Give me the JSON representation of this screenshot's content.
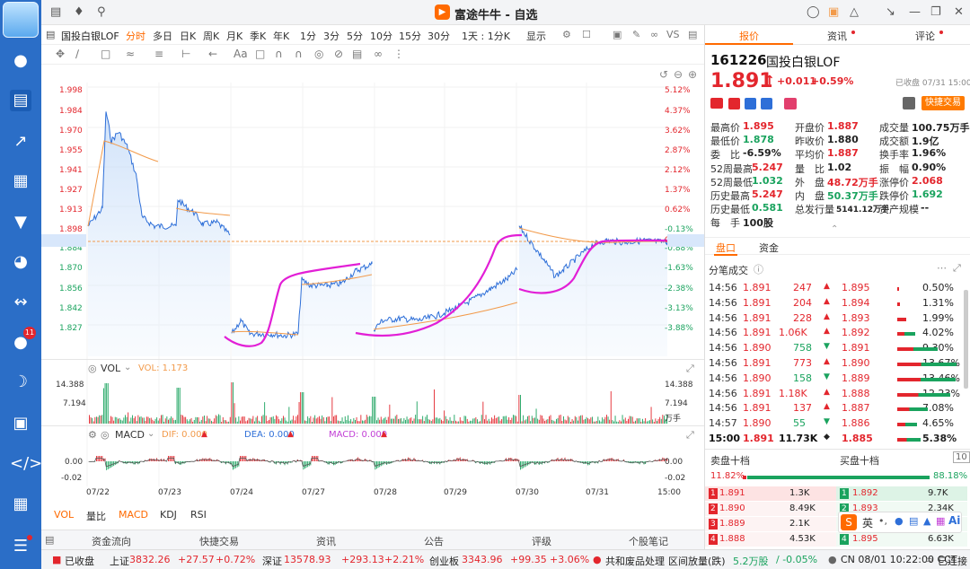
{
  "window": {
    "title": "富途牛牛 - 自选"
  },
  "rail": {
    "badge": "11"
  },
  "toolbar": {
    "stock_name": "国投白银LOF",
    "periods": [
      "分时",
      "多日",
      "日K",
      "周K",
      "月K",
      "季K",
      "年K",
      "1分",
      "3分",
      "5分",
      "10分",
      "15分",
      "30分",
      "1天 : 1分K",
      "显示"
    ],
    "active_period": "分时",
    "vs_label": "VS"
  },
  "chart": {
    "price_ticks": [
      "1.998",
      "1.984",
      "1.970",
      "1.955",
      "1.941",
      "1.927",
      "1.913",
      "1.898",
      "1.891",
      "1.884",
      "1.870",
      "1.856",
      "1.842",
      "1.827"
    ],
    "pct_ticks": [
      "5.12%",
      "4.37%",
      "3.62%",
      "2.87%",
      "2.12%",
      "1.37%",
      "0.62%",
      "-0.13%",
      "0.53%",
      "-0.88%",
      "-1.63%",
      "-2.38%",
      "-3.13%",
      "-3.88%"
    ],
    "current_price_label": "1.891",
    "vol_label": "VOL",
    "vol_value": "VOL: 1.173",
    "vol_ticks_left": [
      "14.388",
      "7.194"
    ],
    "vol_ticks_right": [
      "14.388",
      "7.194",
      "万手"
    ],
    "macd_label": "MACD",
    "dif": "DIF: 0.000",
    "dea": "DEA: 0.000",
    "macd": "MACD: 0.000",
    "macd_ticks": [
      "0.00",
      "-0.02"
    ],
    "dates": [
      "07/22",
      "07/23",
      "07/24",
      "07/27",
      "07/28",
      "07/29",
      "07/30",
      "07/31",
      "15:00"
    ],
    "colors": {
      "up": "#e3262d",
      "down": "#1aa35e",
      "price": "#2e6fd8",
      "avg": "#f29a4a",
      "annotation": "#e21fd6"
    }
  },
  "bottom_tabs": {
    "items": [
      "VOL",
      "量比",
      "MACD",
      "KDJ",
      "RSI"
    ],
    "active": "MACD"
  },
  "panel_bar": {
    "items": [
      "资金流向",
      "快捷交易",
      "资讯",
      "公告",
      "评级",
      "个股笔记"
    ]
  },
  "status": {
    "market": "已收盘",
    "sh_name": "上证",
    "sh_val": "3832.26",
    "sh_chg": "+27.57",
    "sh_pct": "+0.72%",
    "sz_name": "深证",
    "sz_val": "13578.93",
    "sz_chg": "+293.13",
    "sz_pct": "+2.21%",
    "cy_name": "创业板",
    "cy_val": "3343.96",
    "cy_chg": "+99.35",
    "cy_pct": "+3.06%",
    "news": "共和废品处理",
    "interval": "区间放量(跌)",
    "interval_val": "5.2万股",
    "interval_pct": "/ -0.05%",
    "time": "CN 08/01 10:22:00 CCT",
    "conn": "已连接"
  },
  "quote": {
    "tabs": [
      "报价",
      "资讯",
      "评论"
    ],
    "code": "161226",
    "name": "国投白银LOF",
    "close_time": "已收盘 07/31 15:00",
    "price": "1.891",
    "change": "+0.011",
    "change_pct": "+0.59%",
    "quick_trade": "快捷交易",
    "fields": [
      [
        "最高价",
        "1.895",
        "开盘价",
        "1.887",
        "成交量",
        "100.75万手"
      ],
      [
        "最低价",
        "1.878",
        "昨收价",
        "1.880",
        "成交额",
        "1.9亿"
      ],
      [
        "委　比",
        "-6.59%",
        "平均价",
        "1.887",
        "换手率",
        "1.96%"
      ],
      [
        "52周最高",
        "5.247",
        "量　比",
        "1.02",
        "振　幅",
        "0.90%"
      ],
      [
        "52周最低",
        "1.032",
        "外　盘",
        "48.72万手",
        "涨停价",
        "2.068"
      ],
      [
        "历史最高",
        "5.247",
        "内　盘",
        "50.37万手",
        "跌停价",
        "1.692"
      ],
      [
        "历史最低",
        "0.581",
        "总发行量",
        "5141.12万手",
        "资产规模",
        "--"
      ],
      [
        "每　手",
        "100股",
        "",
        "",
        "",
        ""
      ]
    ],
    "subtabs": [
      "盘口",
      "资金"
    ],
    "ticks_title": "分笔成交",
    "ticks": [
      {
        "time": "14:56",
        "price": "1.891",
        "vol": "247",
        "dir": "up",
        "p2": "1.895",
        "pct": "0.50%",
        "w": 2
      },
      {
        "time": "14:56",
        "price": "1.891",
        "vol": "204",
        "dir": "up",
        "p2": "1.894",
        "pct": "1.31%",
        "w": 3
      },
      {
        "time": "14:56",
        "price": "1.891",
        "vol": "228",
        "dir": "up",
        "p2": "1.893",
        "pct": "1.99%",
        "w": 10
      },
      {
        "time": "14:56",
        "price": "1.891",
        "vol": "1.06K",
        "dir": "up",
        "p2": "1.892",
        "pct": "4.02%",
        "w": 20
      },
      {
        "time": "14:56",
        "price": "1.890",
        "vol": "758",
        "dir": "down",
        "p2": "1.891",
        "pct": "9.30%",
        "w": 45
      },
      {
        "time": "14:56",
        "price": "1.891",
        "vol": "773",
        "dir": "up",
        "p2": "1.890",
        "pct": "13.67%",
        "w": 66
      },
      {
        "time": "14:56",
        "price": "1.890",
        "vol": "158",
        "dir": "down",
        "p2": "1.889",
        "pct": "13.46%",
        "w": 65
      },
      {
        "time": "14:56",
        "price": "1.891",
        "vol": "1.18K",
        "dir": "up",
        "p2": "1.888",
        "pct": "12.23%",
        "w": 59
      },
      {
        "time": "14:56",
        "price": "1.891",
        "vol": "137",
        "dir": "up",
        "p2": "1.887",
        "pct": "7.08%",
        "w": 34
      },
      {
        "time": "14:57",
        "price": "1.890",
        "vol": "55",
        "dir": "down",
        "p2": "1.886",
        "pct": "4.65%",
        "w": 22
      },
      {
        "time": "15:00",
        "price": "1.891",
        "vol": "11.73K",
        "dir": "flat",
        "p2": "1.885",
        "pct": "5.38%",
        "w": 26
      }
    ],
    "sell_title": "卖盘十档",
    "buy_title": "买盘十档",
    "ten_btn": "10",
    "sell_pct": "11.82%",
    "buy_pct": "88.18%",
    "book": [
      {
        "sn": "1",
        "sp": "1.891",
        "sv": "1.3K",
        "bn": "1",
        "bp": "1.892",
        "bv": "9.7K"
      },
      {
        "sn": "2",
        "sp": "1.890",
        "sv": "8.49K",
        "bn": "2",
        "bp": "1.893",
        "bv": "2.34K"
      },
      {
        "sn": "3",
        "sp": "1.889",
        "sv": "2.1K",
        "bn": "3",
        "bp": "1.894",
        "bv": ""
      },
      {
        "sn": "4",
        "sp": "1.888",
        "sv": "4.53K",
        "bn": "4",
        "bp": "1.895",
        "bv": "6.63K"
      }
    ],
    "ime_label": "英"
  }
}
